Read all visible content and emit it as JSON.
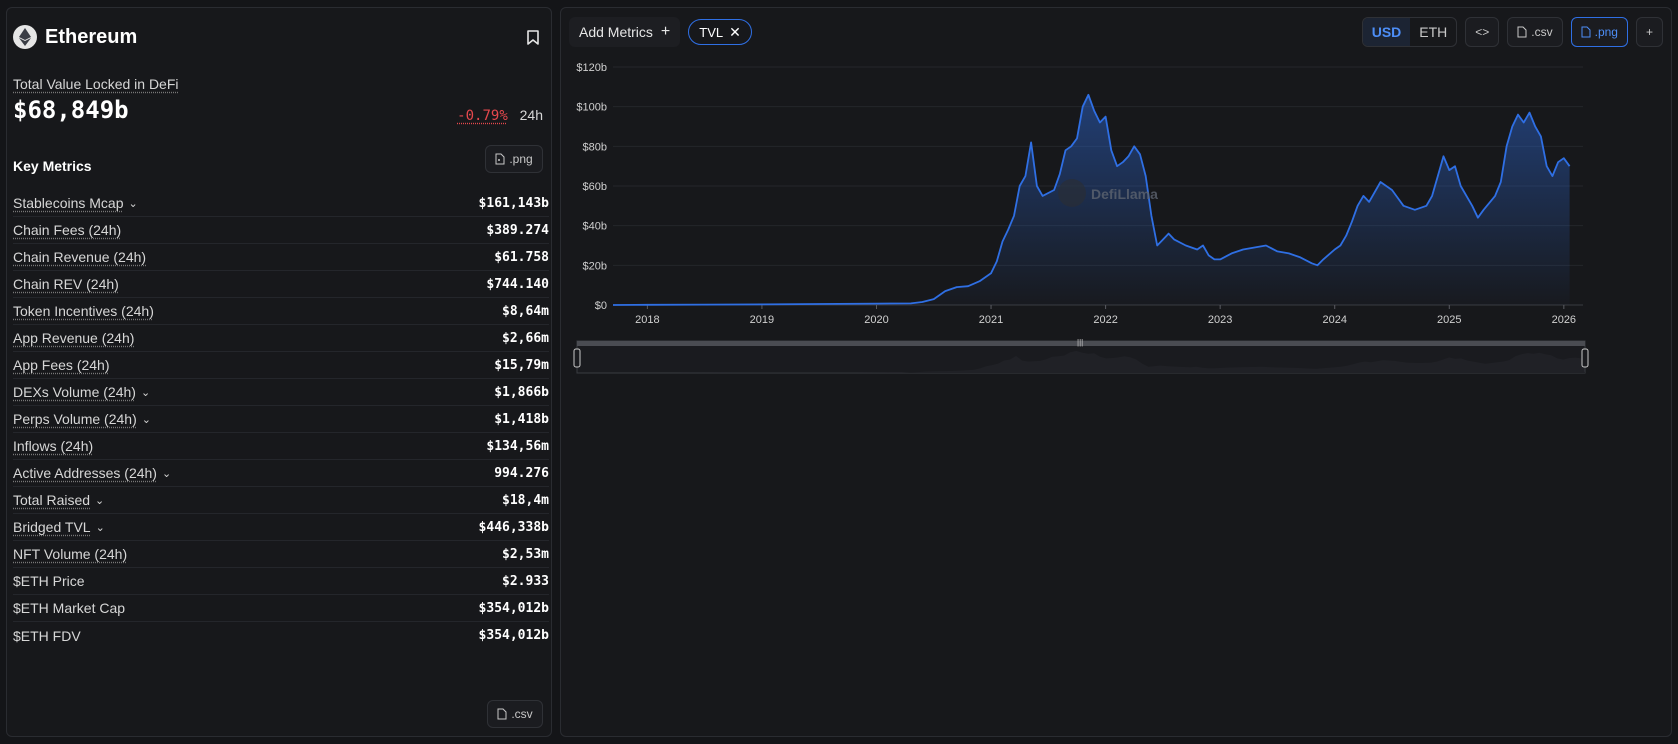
{
  "chain": {
    "name": "Ethereum",
    "logo_icon": "ethereum-icon",
    "bookmark_icon": "bookmark-icon"
  },
  "tvl": {
    "label": "Total Value Locked in DeFi",
    "value": "$68,849b",
    "change": "-0.79%",
    "period": "24h"
  },
  "key_metrics": {
    "title": "Key Metrics",
    "png_label": ".png",
    "csv_label": ".csv",
    "items": [
      {
        "label": "Stablecoins Mcap",
        "value": "$161,143b"
      },
      {
        "label": "Chain Fees (24h)",
        "value": "$389.274"
      },
      {
        "label": "Chain Revenue (24h)",
        "value": "$61.758"
      },
      {
        "label": "Chain REV (24h)",
        "value": "$744.140"
      },
      {
        "label": "Token Incentives (24h)",
        "value": "$8,64m"
      },
      {
        "label": "App Revenue (24h)",
        "value": "$2,66m"
      },
      {
        "label": "App Fees (24h)",
        "value": "$15,79m"
      },
      {
        "label": "DEXs Volume (24h)",
        "value": "$1,866b"
      },
      {
        "label": "Perps Volume (24h)",
        "value": "$1,418b"
      },
      {
        "label": "Inflows (24h)",
        "value": "$134,56m"
      },
      {
        "label": "Active Addresses (24h)",
        "value": "994.276"
      },
      {
        "label": "Total Raised",
        "value": "$18,4m"
      },
      {
        "label": "Bridged TVL",
        "value": "$446,338b"
      },
      {
        "label": "NFT Volume (24h)",
        "value": "$2,53m"
      },
      {
        "label": "$ETH Price",
        "value": "$2.933"
      },
      {
        "label": "$ETH Market Cap",
        "value": "$354,012b"
      },
      {
        "label": "$ETH FDV",
        "value": "$354,012b"
      }
    ]
  },
  "toolbar": {
    "add_metrics": "Add Metrics",
    "tvl_chip": "TVL",
    "currency_usd": "USD",
    "currency_eth": "ETH",
    "embed_label": "<>",
    "csv_label": ".csv",
    "png_label": ".png",
    "plus_label": "+"
  },
  "chart_data": {
    "type": "area",
    "y_tick_labels": [
      "$0",
      "$20b",
      "$40b",
      "$60b",
      "$80b",
      "$100b",
      "$120b"
    ],
    "x_tick_labels": [
      "2018",
      "2019",
      "2020",
      "2021",
      "2022",
      "2023",
      "2024",
      "2025",
      "2026"
    ],
    "ylim": [
      0,
      120
    ],
    "xlim": [
      2017.7,
      2026.08
    ],
    "watermark": "DefiLlama",
    "series": [
      {
        "color": "#2f6fe4",
        "points": [
          [
            2017.7,
            0
          ],
          [
            2018.0,
            0.1
          ],
          [
            2018.5,
            0.2
          ],
          [
            2019.0,
            0.3
          ],
          [
            2019.5,
            0.5
          ],
          [
            2020.0,
            0.7
          ],
          [
            2020.3,
            0.8
          ],
          [
            2020.4,
            1.5
          ],
          [
            2020.5,
            3
          ],
          [
            2020.6,
            7
          ],
          [
            2020.7,
            9
          ],
          [
            2020.8,
            9.5
          ],
          [
            2020.9,
            12
          ],
          [
            2021.0,
            16
          ],
          [
            2021.05,
            22
          ],
          [
            2021.1,
            32
          ],
          [
            2021.15,
            38
          ],
          [
            2021.2,
            45
          ],
          [
            2021.25,
            60
          ],
          [
            2021.3,
            65
          ],
          [
            2021.35,
            82
          ],
          [
            2021.4,
            60
          ],
          [
            2021.45,
            55
          ],
          [
            2021.55,
            58
          ],
          [
            2021.6,
            66
          ],
          [
            2021.65,
            78
          ],
          [
            2021.7,
            80
          ],
          [
            2021.75,
            84
          ],
          [
            2021.8,
            100
          ],
          [
            2021.85,
            106
          ],
          [
            2021.9,
            98
          ],
          [
            2021.95,
            92
          ],
          [
            2022.0,
            95
          ],
          [
            2022.05,
            78
          ],
          [
            2022.1,
            70
          ],
          [
            2022.15,
            72
          ],
          [
            2022.2,
            75
          ],
          [
            2022.25,
            80
          ],
          [
            2022.3,
            76
          ],
          [
            2022.35,
            65
          ],
          [
            2022.4,
            45
          ],
          [
            2022.45,
            30
          ],
          [
            2022.5,
            33
          ],
          [
            2022.55,
            36
          ],
          [
            2022.6,
            33
          ],
          [
            2022.7,
            30
          ],
          [
            2022.8,
            28
          ],
          [
            2022.85,
            30
          ],
          [
            2022.9,
            25
          ],
          [
            2022.95,
            23
          ],
          [
            2023.0,
            23
          ],
          [
            2023.1,
            26
          ],
          [
            2023.2,
            28
          ],
          [
            2023.3,
            29
          ],
          [
            2023.4,
            30
          ],
          [
            2023.5,
            27
          ],
          [
            2023.6,
            26
          ],
          [
            2023.7,
            24
          ],
          [
            2023.8,
            21
          ],
          [
            2023.85,
            20
          ],
          [
            2023.9,
            23
          ],
          [
            2024.0,
            28
          ],
          [
            2024.05,
            30
          ],
          [
            2024.1,
            35
          ],
          [
            2024.15,
            42
          ],
          [
            2024.2,
            50
          ],
          [
            2024.25,
            55
          ],
          [
            2024.3,
            52
          ],
          [
            2024.4,
            62
          ],
          [
            2024.5,
            58
          ],
          [
            2024.6,
            50
          ],
          [
            2024.7,
            48
          ],
          [
            2024.8,
            50
          ],
          [
            2024.85,
            55
          ],
          [
            2024.9,
            65
          ],
          [
            2024.95,
            75
          ],
          [
            2025.0,
            68
          ],
          [
            2025.05,
            70
          ],
          [
            2025.1,
            60
          ],
          [
            2025.2,
            50
          ],
          [
            2025.25,
            44
          ],
          [
            2025.3,
            48
          ],
          [
            2025.4,
            55
          ],
          [
            2025.45,
            62
          ],
          [
            2025.5,
            80
          ],
          [
            2025.55,
            90
          ],
          [
            2025.6,
            96
          ],
          [
            2025.65,
            92
          ],
          [
            2025.7,
            97
          ],
          [
            2025.75,
            90
          ],
          [
            2025.8,
            85
          ],
          [
            2025.85,
            70
          ],
          [
            2025.9,
            65
          ],
          [
            2025.95,
            72
          ],
          [
            2026.0,
            74
          ],
          [
            2026.05,
            70
          ]
        ]
      }
    ]
  }
}
